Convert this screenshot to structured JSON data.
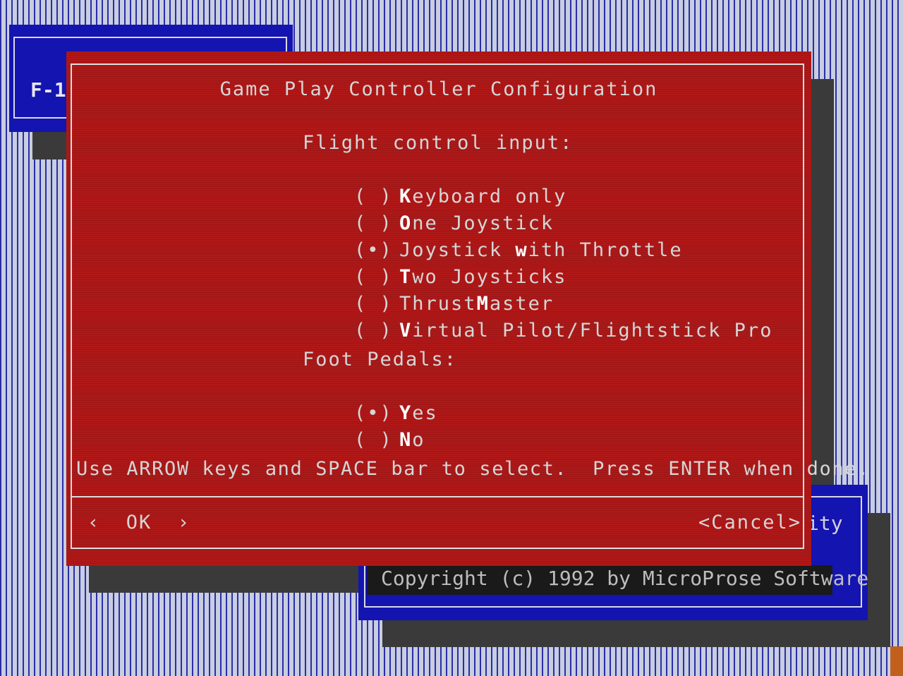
{
  "background": {
    "top_left_window_label": "F-1",
    "right_window_partial_label": "ity",
    "copyright": "Copyright (c) 1992 by MicroProse Software"
  },
  "dialog": {
    "title": "Game Play Controller Configuration",
    "flight_section": {
      "label": "Flight control input:",
      "options": [
        {
          "radio": "( )",
          "pre": "",
          "hot": "K",
          "post": "eyboard only",
          "selected": false
        },
        {
          "radio": "( )",
          "pre": "",
          "hot": "O",
          "post": "ne Joystick",
          "selected": false
        },
        {
          "radio": "(•)",
          "pre": "Joystick ",
          "hot": "w",
          "post": "ith Throttle",
          "selected": true
        },
        {
          "radio": "( )",
          "pre": "",
          "hot": "T",
          "post": "wo Joysticks",
          "selected": false
        },
        {
          "radio": "( )",
          "pre": "Thrust",
          "hot": "M",
          "post": "aster",
          "selected": false
        },
        {
          "radio": "( )",
          "pre": "",
          "hot": "V",
          "post": "irtual Pilot/Flightstick Pro",
          "selected": false
        }
      ]
    },
    "pedals_section": {
      "label": "Foot Pedals:",
      "options": [
        {
          "radio": "(•)",
          "pre": "",
          "hot": "Y",
          "post": "es",
          "selected": true
        },
        {
          "radio": "( )",
          "pre": "",
          "hot": "N",
          "post": "o",
          "selected": false
        }
      ]
    },
    "instructions": "Use ARROW keys and SPACE bar to select.  Press ENTER when done.",
    "ok_label": "‹  OK  ›",
    "cancel_label": "<Cancel>"
  },
  "colors": {
    "dialog_bg": "#b01818",
    "window_blue": "#1414b0",
    "desktop_pattern": "#2a2ea8"
  }
}
